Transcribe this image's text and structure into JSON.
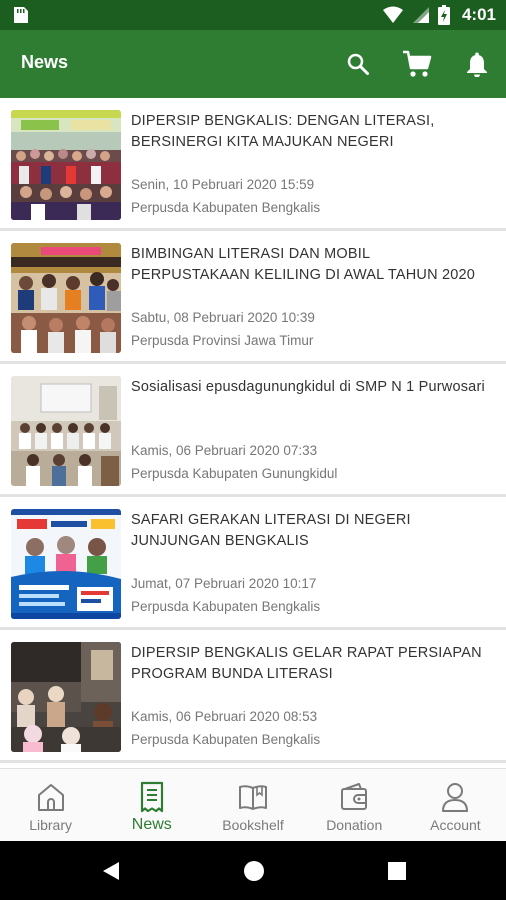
{
  "status_bar": {
    "time": "4:01",
    "icons": [
      "sim-card-icon",
      "wifi-icon",
      "signal-icon",
      "battery-icon"
    ]
  },
  "app_bar": {
    "title": "News",
    "actions": [
      "search-icon",
      "cart-icon",
      "bell-icon"
    ]
  },
  "news": [
    {
      "title": "DIPERSIP BENGKALIS: DENGAN LITERASI, BERSINERGI KITA MAJUKAN NEGERI",
      "date": "Senin, 10 Pebruari 2020 15:59",
      "source": "Perpusda Kabupaten Bengkalis"
    },
    {
      "title": "BIMBINGAN LITERASI DAN MOBIL PERPUSTAKAAN KELILING DI AWAL TAHUN 2020",
      "date": "Sabtu, 08 Pebruari 2020 10:39",
      "source": "Perpusda Provinsi Jawa Timur"
    },
    {
      "title": "Sosialisasi epusdagunungkidul di SMP N 1 Purwosari",
      "date": "Kamis, 06 Pebruari 2020 07:33",
      "source": "Perpusda Kabupaten Gunungkidul"
    },
    {
      "title": "SAFARI GERAKAN LITERASI DI NEGERI JUNJUNGAN BENGKALIS",
      "date": "Jumat, 07 Pebruari 2020 10:17",
      "source": "Perpusda Kabupaten Bengkalis"
    },
    {
      "title": "DIPERSIP BENGKALIS GELAR RAPAT PERSIAPAN PROGRAM BUNDA LITERASI",
      "date": "Kamis, 06 Pebruari 2020 08:53",
      "source": "Perpusda Kabupaten Bengkalis"
    }
  ],
  "bottom_nav": [
    {
      "label": "Library",
      "icon": "home-icon",
      "active": false
    },
    {
      "label": "News",
      "icon": "receipt-icon",
      "active": true
    },
    {
      "label": "Bookshelf",
      "icon": "book-icon",
      "active": false
    },
    {
      "label": "Donation",
      "icon": "wallet-icon",
      "active": false
    },
    {
      "label": "Account",
      "icon": "person-icon",
      "active": false
    }
  ],
  "colors": {
    "status_bar": "#1b5e20",
    "app_bar": "#2e7d32",
    "accent": "#2e7d32",
    "inactive": "#7a7a7a"
  }
}
